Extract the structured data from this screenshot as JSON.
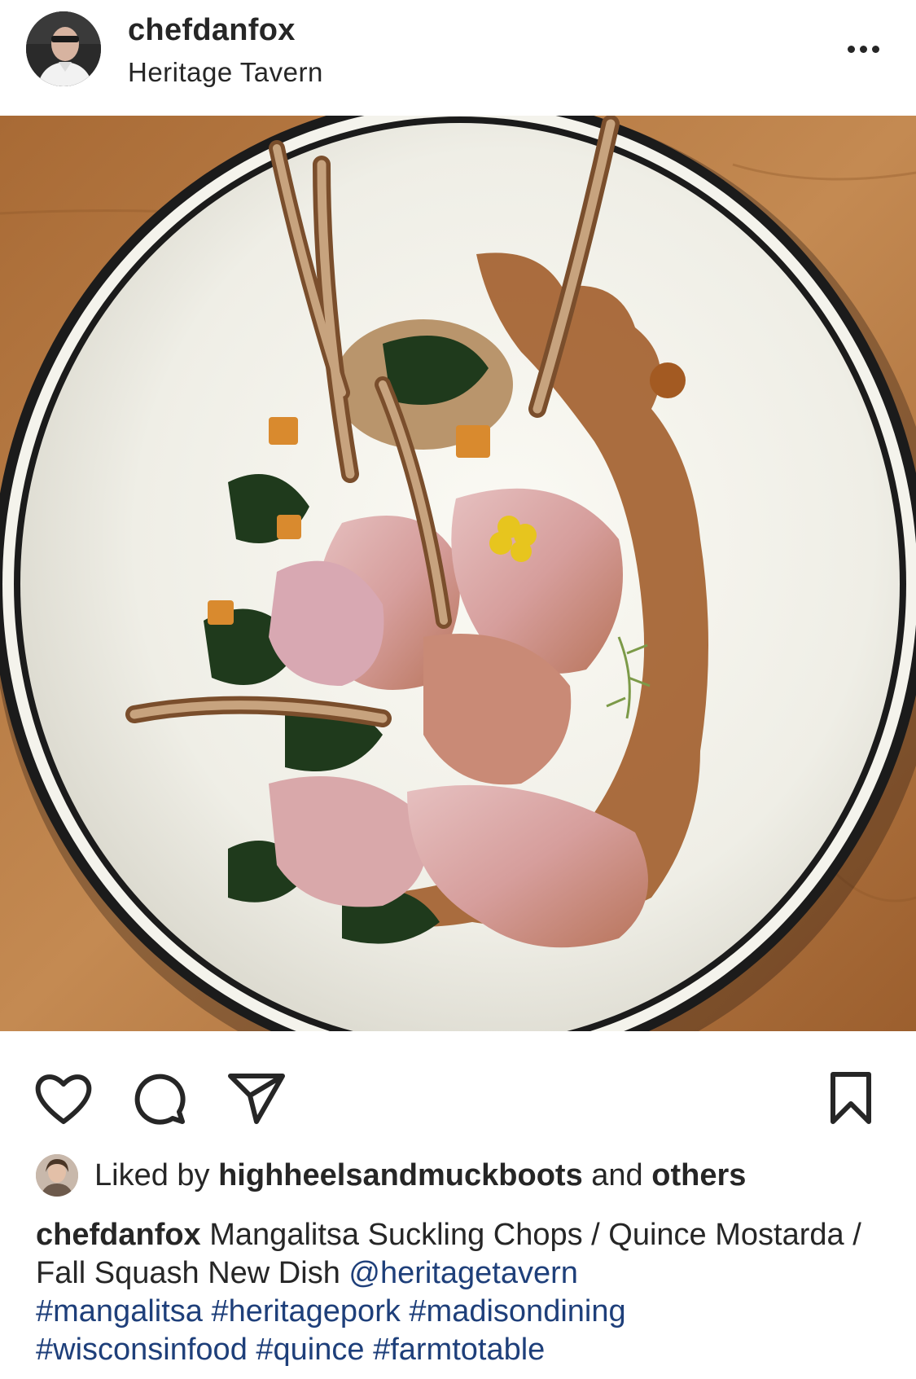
{
  "post": {
    "username": "chefdanfox",
    "location": "Heritage Tavern"
  },
  "icons": {
    "more": "more-options-icon",
    "like": "heart-icon",
    "comment": "comment-icon",
    "share": "send-icon",
    "save": "bookmark-icon"
  },
  "likes": {
    "prefix": "Liked by ",
    "user": "highheelsandmuckboots",
    "middle": " and ",
    "others": "others"
  },
  "caption": {
    "username": "chefdanfox",
    "text": " Mangalitsa Suckling Chops / Quince Mostarda / Fall Squash  New Dish ",
    "mention": "@heritagetavern",
    "hashtags": [
      "#mangalitsa",
      "#heritagepork",
      "#madisondining",
      "#wisconsinfood",
      "#quince",
      "#farmtotable"
    ]
  },
  "colors": {
    "text": "#262626",
    "link": "#1e3f7a",
    "background": "#ffffff"
  }
}
